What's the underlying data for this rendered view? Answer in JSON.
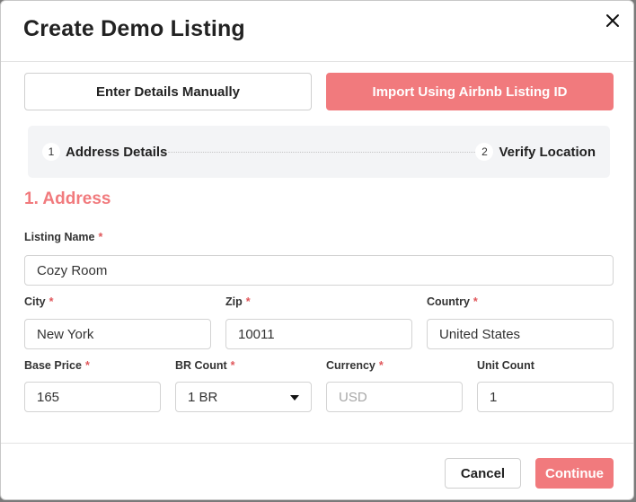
{
  "dialog": {
    "title": "Create Demo Listing",
    "close_icon": "close-icon"
  },
  "modes": {
    "manual_label": "Enter Details Manually",
    "import_label": "Import Using Airbnb Listing ID"
  },
  "stepper": {
    "steps": [
      {
        "number": "1",
        "label": "Address Details"
      },
      {
        "number": "2",
        "label": "Verify Location"
      }
    ]
  },
  "section": {
    "title": "1. Address"
  },
  "form": {
    "required_marker": "*",
    "listing_name": {
      "label": "Listing Name",
      "value": "Cozy Room"
    },
    "city": {
      "label": "City",
      "value": "New York"
    },
    "zip": {
      "label": "Zip",
      "value": "10011"
    },
    "country": {
      "label": "Country",
      "value": "United States"
    },
    "base_price": {
      "label": "Base Price",
      "value": "165"
    },
    "br_count": {
      "label": "BR Count",
      "value": "1 BR"
    },
    "currency": {
      "label": "Currency",
      "value": "USD"
    },
    "unit_count": {
      "label": "Unit Count",
      "value": "1"
    }
  },
  "footer": {
    "cancel_label": "Cancel",
    "continue_label": "Continue"
  },
  "colors": {
    "accent": "#f17a7d",
    "required": "#e0575b",
    "stepper_bg": "#f3f4f6"
  }
}
